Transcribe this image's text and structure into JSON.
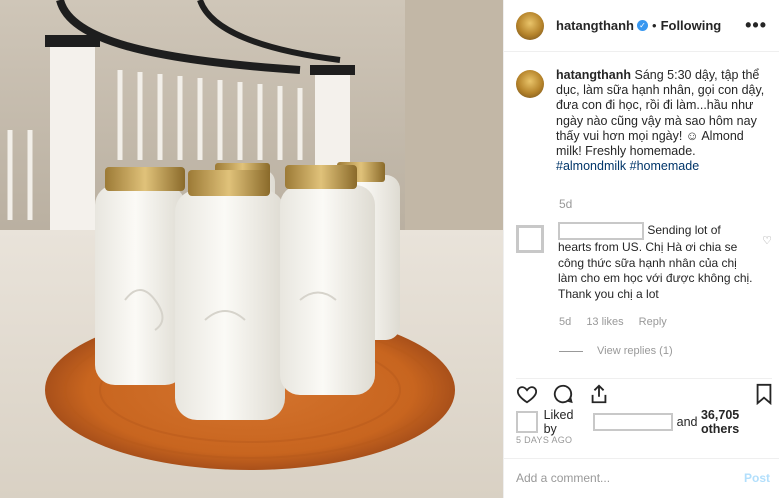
{
  "post": {
    "username": "hatangthanh",
    "follow_status": "Following",
    "separator": "•",
    "more": "•••",
    "caption_user": "hatangthanh",
    "caption_text": "Sáng 5:30 dậy, tập thể dục, làm sữa hạnh nhân, gọi con dậy, đưa con đi học, rồi đi làm...hầu như ngày nào cũng vậy mà sao hôm nay thấy vui hơn mọi ngày! ☺ Almond milk! Freshly homemade.",
    "hashtag1": "#almondmilk",
    "hashtag2": "#homemade",
    "caption_time": "5d"
  },
  "comment": {
    "text": "Sending lot of hearts from US. Chị Hà ơi chia se công thức sữa hạnh nhân của chị làm cho em học với được không chị. Thank you chị a lot",
    "time": "5d",
    "likes": "13 likes",
    "reply": "Reply",
    "view_replies": "View replies (1)"
  },
  "likes": {
    "prefix": "Liked by",
    "suffix": "and",
    "count": "36,705 others"
  },
  "date": "5 DAYS AGO",
  "add_comment": {
    "placeholder": "Add a comment...",
    "post": "Post"
  },
  "icons": [
    "verified-icon",
    "heart-icon",
    "comment-icon",
    "share-icon",
    "bookmark-icon",
    "more-icon"
  ]
}
